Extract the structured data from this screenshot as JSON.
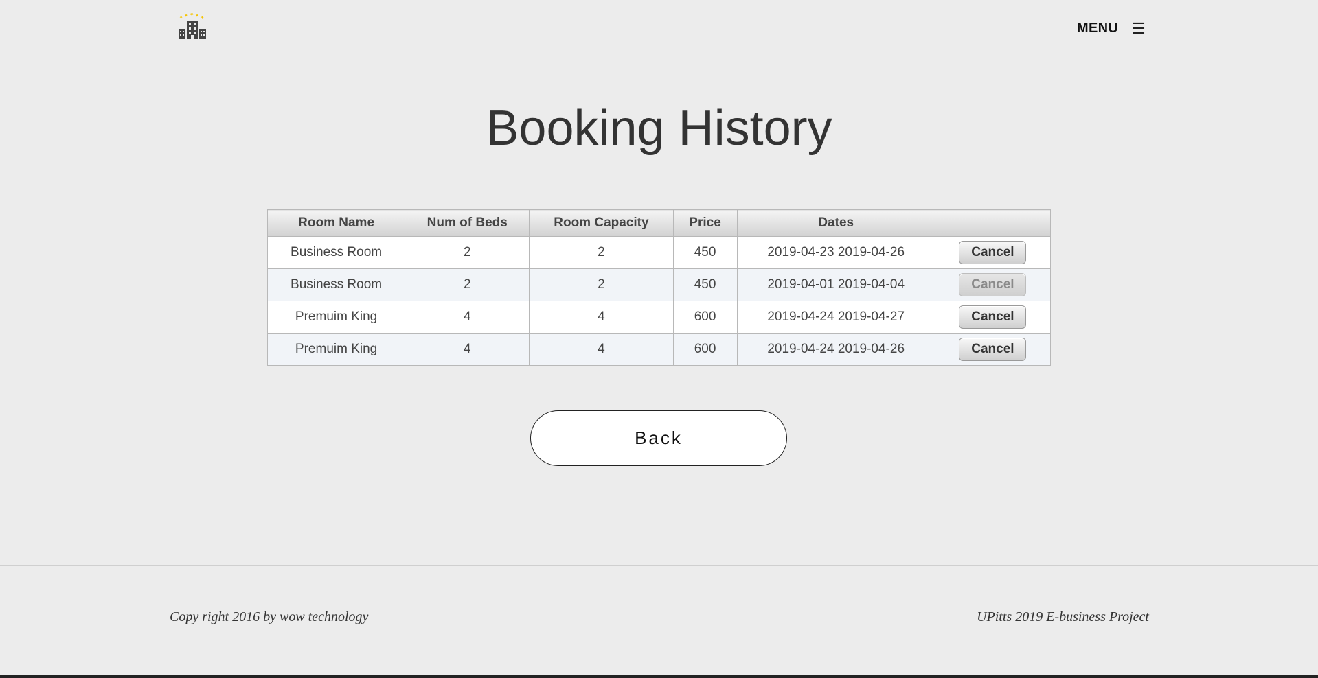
{
  "header": {
    "logo_icon": "hotel-buildings-icon",
    "menu_label": "MENU",
    "menu_icon": "hamburger-icon",
    "menu_glyph": "☰"
  },
  "page": {
    "title": "Booking History"
  },
  "table": {
    "columns": [
      "Room Name",
      "Num of Beds",
      "Room Capacity",
      "Price",
      "Dates",
      ""
    ],
    "rows": [
      {
        "room_name": "Business Room",
        "beds": "2",
        "capacity": "2",
        "price": "450",
        "dates": "2019-04-23 2019-04-26",
        "action": "Cancel",
        "action_enabled": true
      },
      {
        "room_name": "Business Room",
        "beds": "2",
        "capacity": "2",
        "price": "450",
        "dates": "2019-04-01 2019-04-04",
        "action": "Cancel",
        "action_enabled": false
      },
      {
        "room_name": "Premuim King",
        "beds": "4",
        "capacity": "4",
        "price": "600",
        "dates": "2019-04-24 2019-04-27",
        "action": "Cancel",
        "action_enabled": true
      },
      {
        "room_name": "Premuim King",
        "beds": "4",
        "capacity": "4",
        "price": "600",
        "dates": "2019-04-24 2019-04-26",
        "action": "Cancel",
        "action_enabled": true
      }
    ]
  },
  "back_button": {
    "label": "Back"
  },
  "footer": {
    "left": "Copy right 2016 by wow technology",
    "right": "UPitts 2019 E-business Project"
  },
  "colors": {
    "background": "#ececec",
    "logo_star": "#f5c400",
    "logo_building": "#444444"
  }
}
